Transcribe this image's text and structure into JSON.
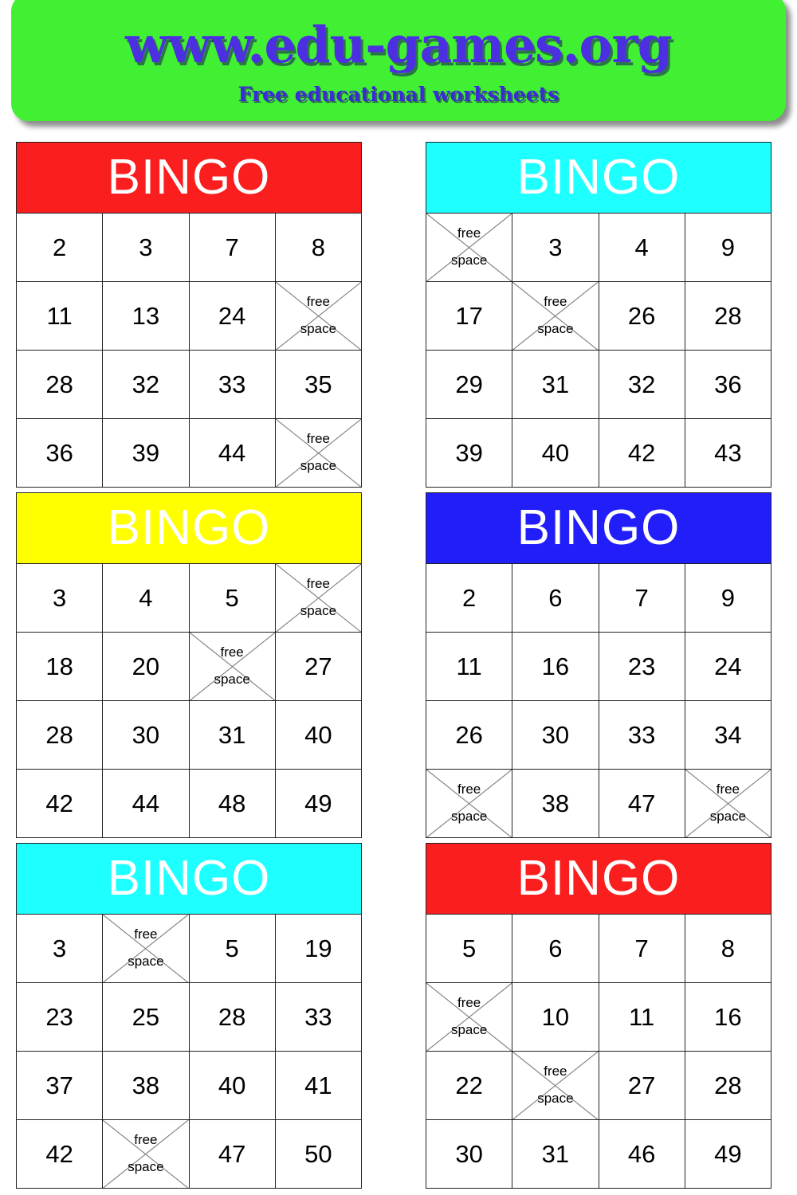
{
  "banner": {
    "title": "www.edu-games.org",
    "subtitle": "Free educational worksheets",
    "background_color": "#41f033",
    "text_color": "#4b2fe0"
  },
  "free_space": {
    "line1": "free",
    "line2": "space"
  },
  "cards": [
    {
      "title": "BINGO",
      "header_color": "#fa1e1e",
      "rows": [
        [
          "2",
          "3",
          "7",
          "8"
        ],
        [
          "11",
          "13",
          "24",
          "FREE"
        ],
        [
          "28",
          "32",
          "33",
          "35"
        ],
        [
          "36",
          "39",
          "44",
          "FREE"
        ]
      ]
    },
    {
      "title": "BINGO",
      "header_color": "#1effff",
      "rows": [
        [
          "FREE",
          "3",
          "4",
          "9"
        ],
        [
          "17",
          "FREE",
          "26",
          "28"
        ],
        [
          "29",
          "31",
          "32",
          "36"
        ],
        [
          "39",
          "40",
          "42",
          "43"
        ]
      ]
    },
    {
      "title": "BINGO",
      "header_color": "#ffff00",
      "rows": [
        [
          "3",
          "4",
          "5",
          "FREE"
        ],
        [
          "18",
          "20",
          "FREE",
          "27"
        ],
        [
          "28",
          "30",
          "31",
          "40"
        ],
        [
          "42",
          "44",
          "48",
          "49"
        ]
      ]
    },
    {
      "title": "BINGO",
      "header_color": "#211efa",
      "rows": [
        [
          "2",
          "6",
          "7",
          "9"
        ],
        [
          "11",
          "16",
          "23",
          "24"
        ],
        [
          "26",
          "30",
          "33",
          "34"
        ],
        [
          "FREE",
          "38",
          "47",
          "FREE"
        ]
      ]
    },
    {
      "title": "BINGO",
      "header_color": "#1effff",
      "rows": [
        [
          "3",
          "FREE",
          "5",
          "19"
        ],
        [
          "23",
          "25",
          "28",
          "33"
        ],
        [
          "37",
          "38",
          "40",
          "41"
        ],
        [
          "42",
          "FREE",
          "47",
          "50"
        ]
      ]
    },
    {
      "title": "BINGO",
      "header_color": "#fa1e1e",
      "rows": [
        [
          "5",
          "6",
          "7",
          "8"
        ],
        [
          "FREE",
          "10",
          "11",
          "16"
        ],
        [
          "22",
          "FREE",
          "27",
          "28"
        ],
        [
          "30",
          "31",
          "46",
          "49"
        ]
      ]
    }
  ]
}
